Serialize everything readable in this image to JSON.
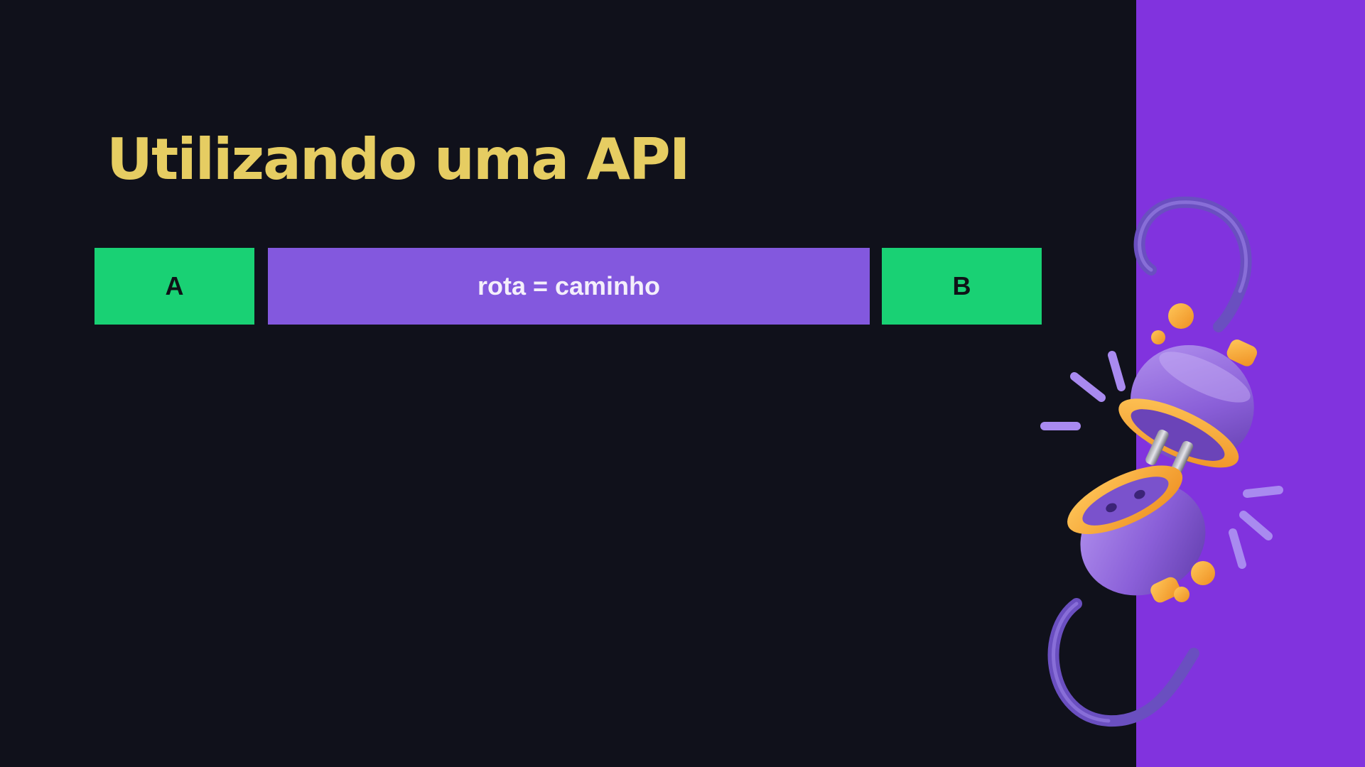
{
  "slide": {
    "title": "Utilizando uma API"
  },
  "diagram": {
    "left_box": "A",
    "route_box": "rota = caminho",
    "right_box": "B"
  },
  "illustration": {
    "icon": "plug-socket-disconnected-icon"
  },
  "colors": {
    "background": "#10111b",
    "side_panel": "#8133de",
    "title": "#e6cd62",
    "endpoint_box": "#19d174",
    "route_box": "#8358de",
    "plug_purple": "#8b62d8",
    "plug_orange": "#f4a93a"
  }
}
